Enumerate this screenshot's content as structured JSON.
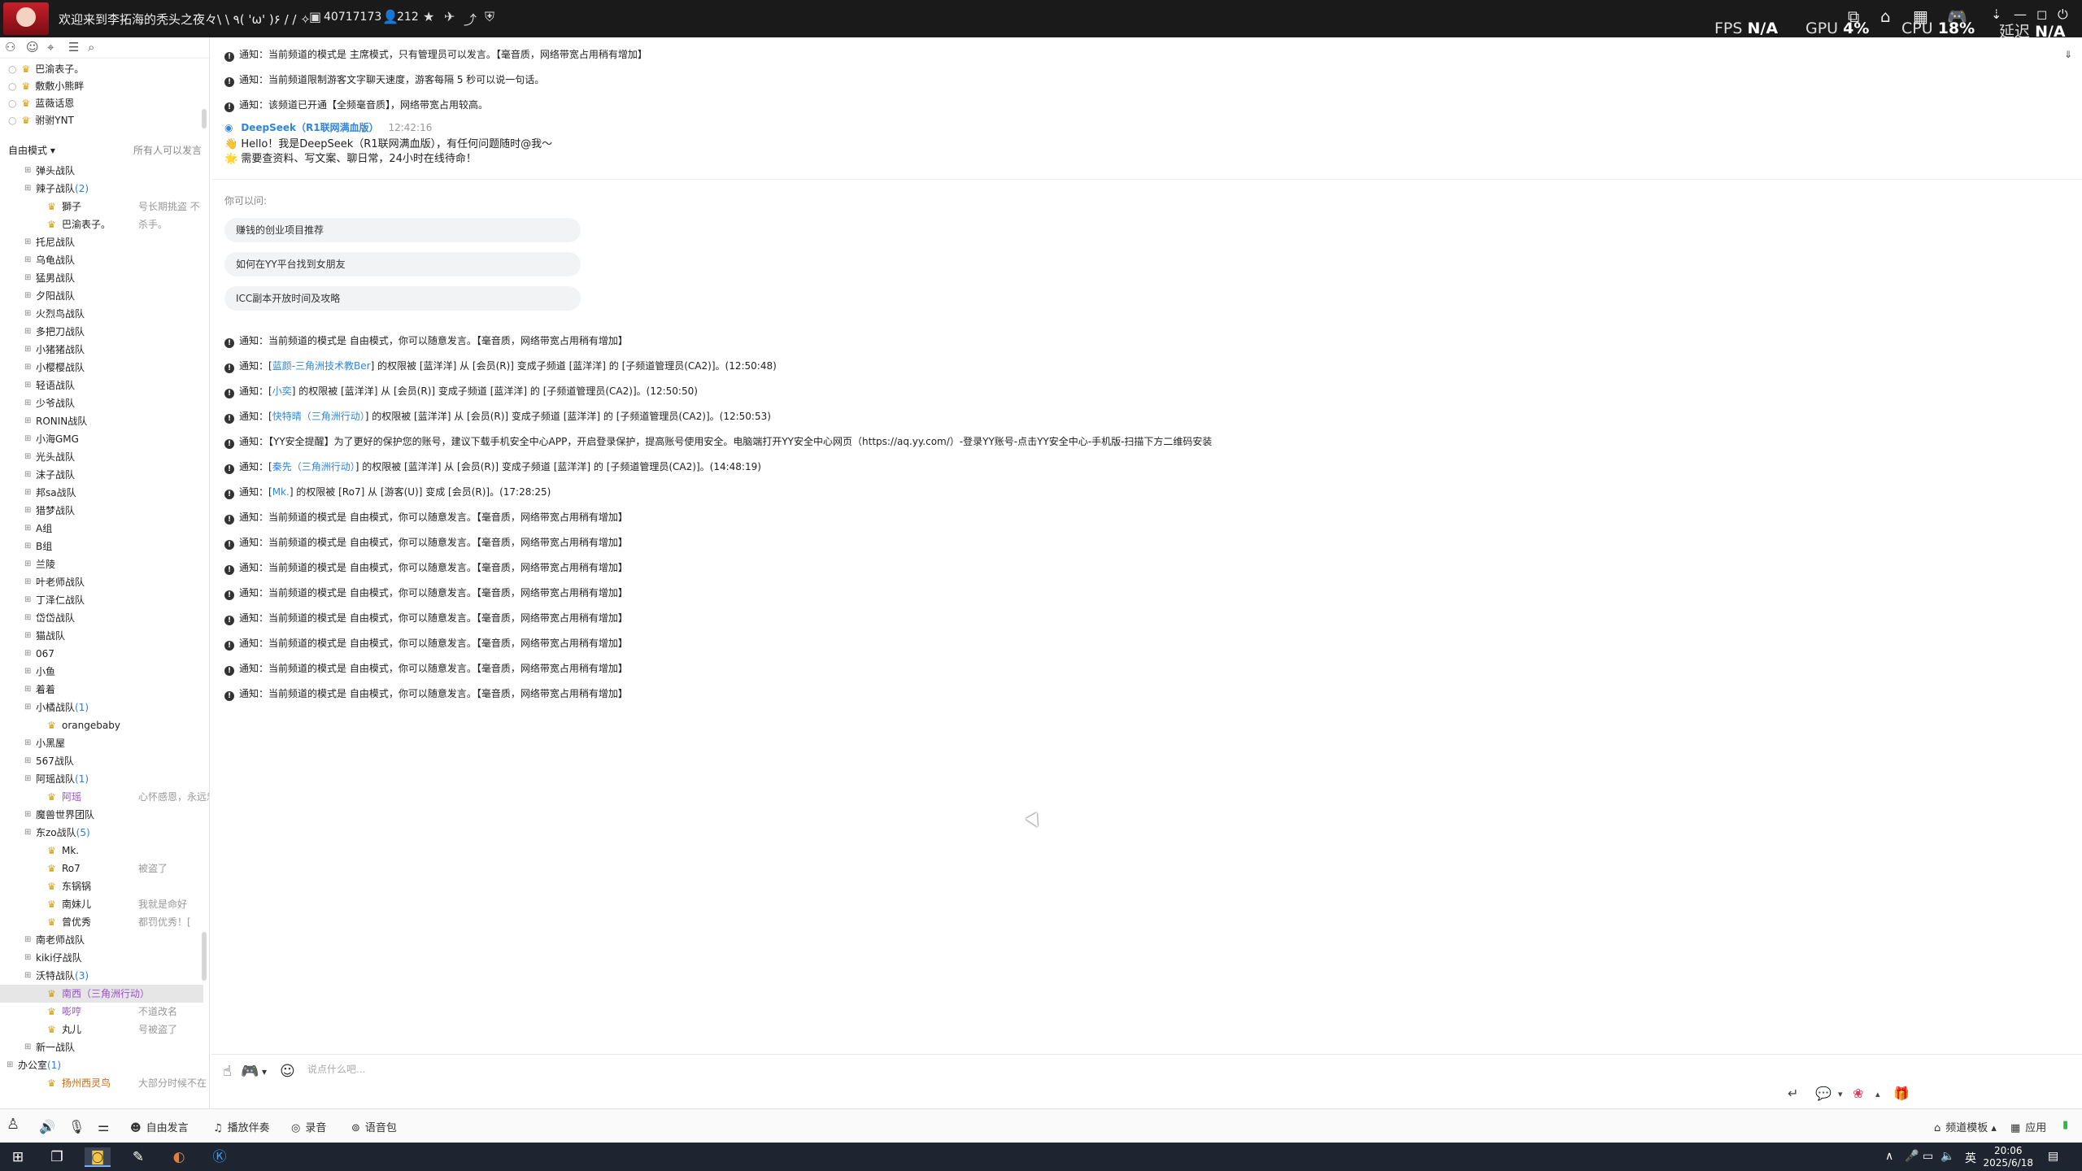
{
  "titlebar": {
    "title": "欢迎来到李拓海的秃头之夜々\\ \\ ٩( 'ω' )۶ / / ✧",
    "channel_id": "40717173",
    "online_count": "212",
    "fps_label": "FPS",
    "fps_value": "N/A",
    "gpu_label": "GPU",
    "gpu_value": "4%",
    "cpu_label": "CPU",
    "cpu_value": "18%",
    "latency_label": "延迟",
    "latency_value": "N/A"
  },
  "favorites": [
    "巴渝表子。",
    "敷敷小熊畔",
    "蓝薇话恩",
    "驸驸YNT"
  ],
  "mode": {
    "label": "自由模式",
    "right": "所有人可以发言"
  },
  "tree": [
    {
      "t": "ch",
      "name": "弹头战队"
    },
    {
      "t": "ch",
      "name": "辣子战队",
      "cnt": "(2)"
    },
    {
      "t": "u",
      "name": "獅子",
      "sig": "号长期挑盗 不"
    },
    {
      "t": "u",
      "name": "巴渝表子。",
      "sig": "杀手。"
    },
    {
      "t": "ch",
      "name": "托尼战队"
    },
    {
      "t": "ch",
      "name": "乌龟战队"
    },
    {
      "t": "ch",
      "name": "猛男战队"
    },
    {
      "t": "ch",
      "name": "夕阳战队"
    },
    {
      "t": "ch",
      "name": "火烈鸟战队"
    },
    {
      "t": "ch",
      "name": "多把刀战队"
    },
    {
      "t": "ch",
      "name": "小猪猪战队"
    },
    {
      "t": "ch",
      "name": "小樱樱战队"
    },
    {
      "t": "ch",
      "name": "轻语战队"
    },
    {
      "t": "ch",
      "name": "少爷战队"
    },
    {
      "t": "ch",
      "name": "RONIN战队"
    },
    {
      "t": "ch",
      "name": "小海GMG"
    },
    {
      "t": "ch",
      "name": "光头战队"
    },
    {
      "t": "ch",
      "name": "沫子战队"
    },
    {
      "t": "ch",
      "name": "邦sa战队"
    },
    {
      "t": "ch",
      "name": "猎梦战队"
    },
    {
      "t": "ch",
      "name": "A组"
    },
    {
      "t": "ch",
      "name": "B组"
    },
    {
      "t": "ch",
      "name": "兰陵"
    },
    {
      "t": "ch",
      "name": "叶老师战队"
    },
    {
      "t": "ch",
      "name": "丁泽仁战队"
    },
    {
      "t": "ch",
      "name": "岱岱战队"
    },
    {
      "t": "ch",
      "name": "猫战队"
    },
    {
      "t": "ch",
      "name": "067"
    },
    {
      "t": "ch",
      "name": "小鱼"
    },
    {
      "t": "ch",
      "name": "着着"
    },
    {
      "t": "ch",
      "name": "小橘战队",
      "cnt": "(1)"
    },
    {
      "t": "u",
      "name": "orangebaby",
      "sig": ""
    },
    {
      "t": "ch",
      "name": "小黑屋"
    },
    {
      "t": "ch",
      "name": "567战队"
    },
    {
      "t": "ch",
      "name": "阿瑶战队",
      "cnt": "(1)"
    },
    {
      "t": "u",
      "name": "阿瑶",
      "sig": "心怀感恩，永远忠诚",
      "cls": "purple"
    },
    {
      "t": "ch",
      "name": "魔兽世界团队"
    },
    {
      "t": "ch",
      "name": "东zo战队",
      "cnt": "(5)"
    },
    {
      "t": "u",
      "name": "Mk.",
      "sig": ""
    },
    {
      "t": "u",
      "name": "Ro7",
      "sig": "被盗了"
    },
    {
      "t": "u",
      "name": "东锅锅",
      "sig": ""
    },
    {
      "t": "u",
      "name": "南妹儿",
      "sig": "我就是命好"
    },
    {
      "t": "u",
      "name": "曾优秀",
      "sig": "都罚优秀！["
    },
    {
      "t": "ch",
      "name": "南老师战队"
    },
    {
      "t": "ch",
      "name": "kiki仔战队"
    },
    {
      "t": "ch",
      "name": "沃特战队",
      "cnt": "(3)"
    },
    {
      "t": "u",
      "name": "南西（三角洲行动）",
      "sig": "",
      "cls": "purple",
      "sel": true
    },
    {
      "t": "u",
      "name": "嘭哼",
      "sig": "不道改名",
      "cls": "purple"
    },
    {
      "t": "u",
      "name": "丸儿",
      "sig": "号被盗了"
    },
    {
      "t": "ch",
      "name": "新一战队"
    },
    {
      "t": "ch0",
      "name": "办公室",
      "cnt": "(1)"
    },
    {
      "t": "u",
      "name": "扬州西灵鸟",
      "sig": "大部分时候不在",
      "cls": "orange"
    }
  ],
  "notices_top": [
    "通知：当前频道的模式是 主席模式，只有管理员可以发言。【毫音质，网络带宽占用稍有增加】",
    "通知：当前频道限制游客文字聊天速度，游客每隔 5 秒可以说一句话。",
    "通知：该频道已开通【全频毫音质】，网络带宽占用较高。"
  ],
  "deepseek": {
    "name": "DeepSeek（R1联网满血版）",
    "time": "12:42:16",
    "line1": "👋 Hello！我是DeepSeek（R1联网满血版），有任何问题随时@我～",
    "line2": "🌟 需要查资料、写文案、聊日常，24小时在线待命！",
    "ask_label": "你可以问:",
    "suggestions": [
      "赚钱的创业项目推荐",
      "如何在YY平台找到女朋友",
      "ICC副本开放时间及攻略"
    ]
  },
  "notices": [
    {
      "pre": "通知：当前频道的模式是 自由模式，你可以随意发言。【毫音质，网络带宽占用稍有增加】"
    },
    {
      "pre": "通知：[",
      "link": "蓝颜-三角洲技术教Ber",
      "post": "] 的权限被 [蓝洋洋] 从 [会员(R)] 变成子频道 [蓝洋洋] 的 [子频道管理员(CA2)]。(12:50:48)"
    },
    {
      "pre": "通知：[",
      "link": "小奕",
      "post": "] 的权限被 [蓝洋洋] 从 [会员(R)] 变成子频道 [蓝洋洋] 的 [子频道管理员(CA2)]。(12:50:50)"
    },
    {
      "pre": "通知：[",
      "link": "快特晴（三角洲行动）",
      "post": "] 的权限被 [蓝洋洋] 从 [会员(R)] 变成子频道 [蓝洋洋] 的 [子频道管理员(CA2)]。(12:50:53)"
    },
    {
      "pre": "通知：【YY安全提醒】为了更好的保护您的账号，建议下载手机安全中心APP，开启登录保护，提高账号使用安全。电脑端打开YY安全中心网页（https://aq.yy.com/）-登录YY账号-点击YY安全中心-手机版-扫描下方二维码安装"
    },
    {
      "pre": "通知：[",
      "link": "秦先（三角洲行动）",
      "post": "] 的权限被 [蓝洋洋] 从 [会员(R)] 变成子频道 [蓝洋洋] 的 [子频道管理员(CA2)]。(14:48:19)"
    },
    {
      "pre": "通知：[",
      "link": "Mk.",
      "post": "] 的权限被 [Ro7] 从 [游客(U)] 变成 [会员(R)]。(17:28:25)"
    },
    {
      "pre": "通知：当前频道的模式是 自由模式，你可以随意发言。【毫音质，网络带宽占用稍有增加】"
    },
    {
      "pre": "通知：当前频道的模式是 自由模式，你可以随意发言。【毫音质，网络带宽占用稍有增加】"
    },
    {
      "pre": "通知：当前频道的模式是 自由模式，你可以随意发言。【毫音质，网络带宽占用稍有增加】"
    },
    {
      "pre": "通知：当前频道的模式是 自由模式，你可以随意发言。【毫音质，网络带宽占用稍有增加】"
    },
    {
      "pre": "通知：当前频道的模式是 自由模式，你可以随意发言。【毫音质，网络带宽占用稍有增加】"
    },
    {
      "pre": "通知：当前频道的模式是 自由模式，你可以随意发言。【毫音质，网络带宽占用稍有增加】"
    },
    {
      "pre": "通知：当前频道的模式是 自由模式，你可以随意发言。【毫音质，网络带宽占用稍有增加】"
    },
    {
      "pre": "通知：当前频道的模式是 自由模式，你可以随意发言。【毫音质，网络带宽占用稍有增加】"
    }
  ],
  "input": {
    "placeholder": "说点什么吧..."
  },
  "bottombar": {
    "free_speak": "自由发言",
    "accompany": "播放伴奏",
    "record": "录音",
    "voice_pack": "语音包",
    "template": "频道模板",
    "apps": "应用"
  },
  "taskbar": {
    "time": "20:06",
    "date": "2025/6/18",
    "ime": "英"
  }
}
